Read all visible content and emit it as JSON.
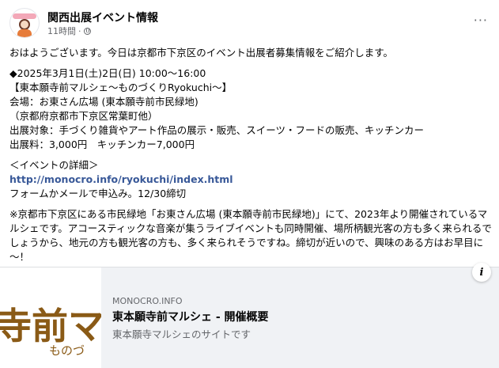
{
  "post": {
    "page_name": "関西出展イベント情報",
    "time": "11時間",
    "dot": "·",
    "more": "···",
    "lines": {
      "l1": "おはようございます。今日は京都市下京区のイベント出展者募集情報をご紹介します。",
      "l2": "◆2025年3月1日(土)2日(日) 10:00～16:00",
      "l3": "【東本願寺前マルシェ～ものづくりRyokuchi～】",
      "l4": "会場：お東さん広場 (東本願寺前市民緑地)",
      "l5": "（京都府京都市下京区常葉町他）",
      "l6": "出展対象：手づくり雑貨やアート作品の展示・販売、スイーツ・フードの販売、キッチンカー",
      "l7": "出展料：3,000円　キッチンカー7,000円",
      "l8": "＜イベントの詳細＞",
      "l9": "http://monocro.info/ryokuchi/index.html",
      "l10": "フォームかメールで申込み。12/30締切",
      "p1": "※京都市下京区にある市民緑地「お東さん広場 (東本願寺前市民緑地)」にて、2023年より開催されているマルシェです。アコースティックな音楽が集うライブイベントも同時開催、場所柄観光客の方も多く来られるでしょうから、地元の方も観光客の方も、多く来られそうですね。締切が近いので、興味のある方はお早目に～！"
    }
  },
  "preview": {
    "thumb_big": "寺前マ",
    "thumb_small": "ものづ",
    "domain": "MONOCRO.INFO",
    "title": "東本願寺前マルシェ - 開催概要",
    "desc": "東本願寺マルシェのサイトです",
    "info": "i"
  }
}
